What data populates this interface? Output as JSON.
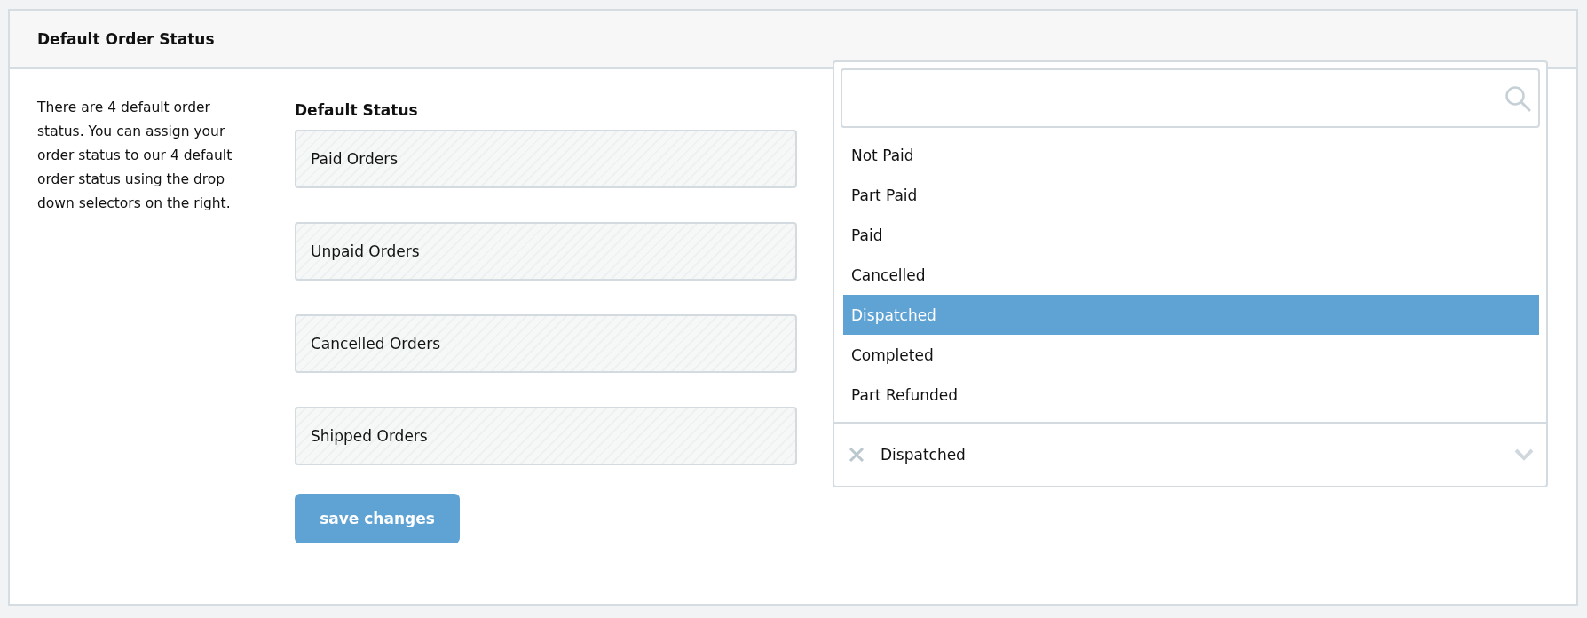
{
  "panel": {
    "title": "Default Order Status"
  },
  "description": "There are 4 default order status. You can assign your order status to our 4 default order status using the drop down selectors on the right.",
  "column_heading": "Default Status",
  "statuses": [
    {
      "label": "Paid Orders"
    },
    {
      "label": "Unpaid Orders"
    },
    {
      "label": "Cancelled Orders"
    },
    {
      "label": "Shipped Orders"
    }
  ],
  "save_button": "save changes",
  "dropdown": {
    "options": [
      {
        "label": "Not Paid",
        "selected": false
      },
      {
        "label": "Part Paid",
        "selected": false
      },
      {
        "label": "Paid",
        "selected": false
      },
      {
        "label": "Cancelled",
        "selected": false
      },
      {
        "label": "Dispatched",
        "selected": true
      },
      {
        "label": "Completed",
        "selected": false
      },
      {
        "label": "Part Refunded",
        "selected": false
      }
    ],
    "value": "Dispatched"
  }
}
